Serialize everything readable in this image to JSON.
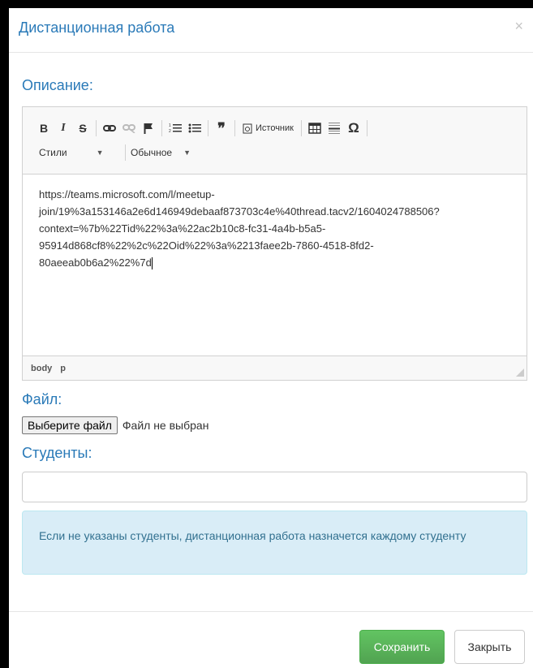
{
  "modal": {
    "title": "Дистанционная работа",
    "close_glyph": "×"
  },
  "description": {
    "label": "Описание:",
    "toolbar": {
      "bold": "B",
      "italic": "I",
      "strike": "S",
      "quote": "❞",
      "source_label": "Источник",
      "omega": "Ω",
      "styles_label": "Стили",
      "format_label": "Обычное"
    },
    "content_lines": [
      "https://teams.microsoft.com/l/meetup-",
      "join/19%3a153146a2e6d146949debaaf873703c4e%40thread.tacv2/1604024788506?",
      "context=%7b%22Tid%22%3a%22ac2b10c8-fc31-4a4b-b5a5-",
      "95914d868cf8%22%2c%22Oid%22%3a%2213faee2b-7860-4518-8fd2-",
      "80aeeab0b6a2%22%7d"
    ],
    "path": [
      "body",
      "p"
    ]
  },
  "file": {
    "label": "Файл:",
    "button_label": "Выберите файл",
    "status": "Файл не выбран"
  },
  "students": {
    "label": "Студенты:",
    "value": "",
    "note": "Если не указаны студенты, дистанционная работа назначется каждому студенту"
  },
  "footer": {
    "save_label": "Сохранить",
    "close_label": "Закрыть"
  },
  "colors": {
    "accent": "#2a7ab8",
    "save_button": "#5cb85c",
    "info_bg": "#d9edf7",
    "info_text": "#31708f"
  }
}
